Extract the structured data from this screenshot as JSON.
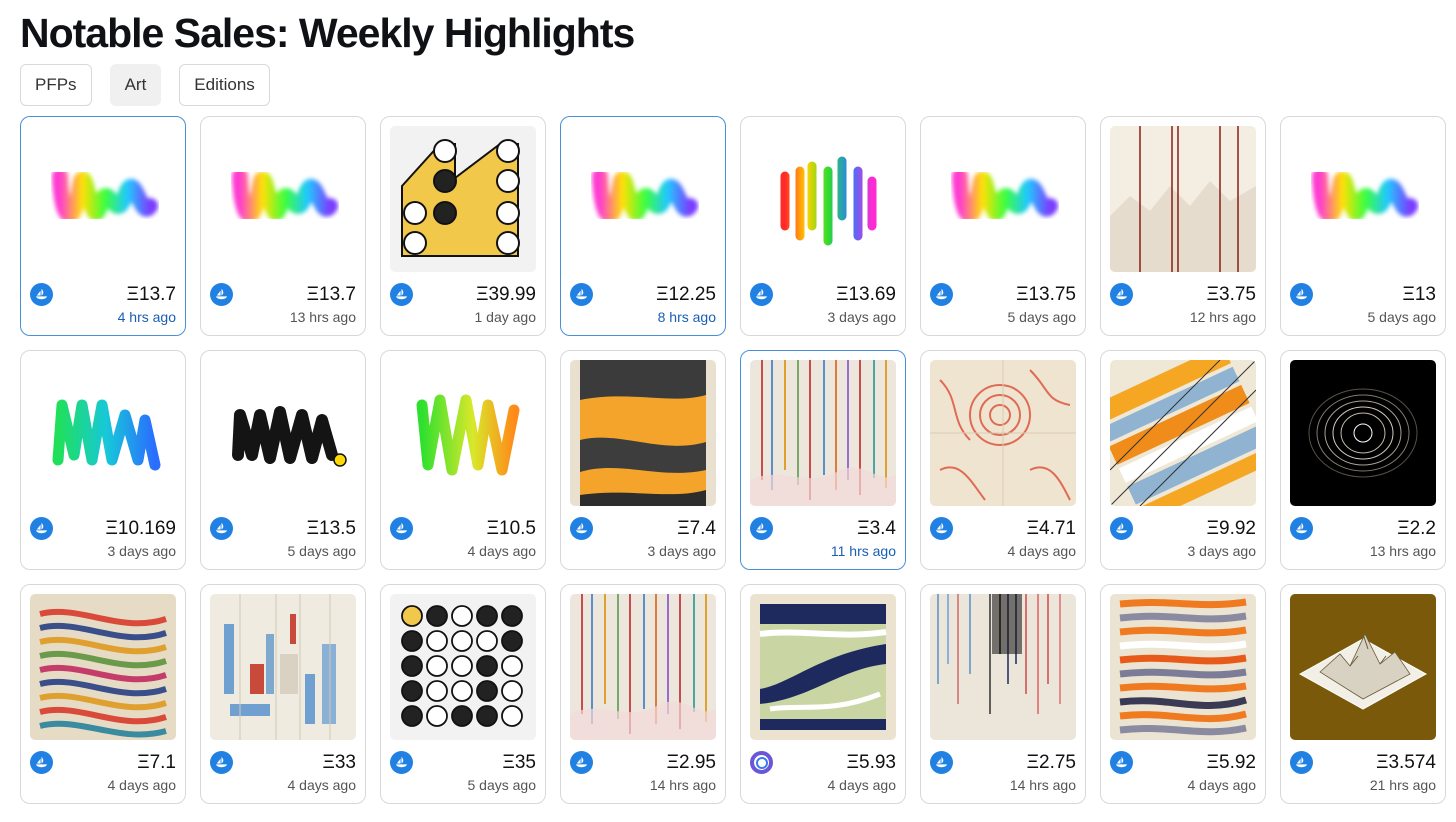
{
  "page": {
    "title": "Notable Sales: Weekly Highlights"
  },
  "tabs": [
    {
      "label": "PFPs",
      "active": false
    },
    {
      "label": "Art",
      "active": true
    },
    {
      "label": "Editions",
      "active": false
    }
  ],
  "cards": [
    {
      "price": "Ξ13.7",
      "time": "4 hrs ago",
      "art": "fuzzy-rainbow",
      "marketplace": "opensea-icon",
      "selected": true
    },
    {
      "price": "Ξ13.7",
      "time": "13 hrs ago",
      "art": "fuzzy-rainbow",
      "marketplace": "opensea-icon",
      "selected": false
    },
    {
      "price": "Ξ39.99",
      "time": "1 day ago",
      "art": "circles-yellow",
      "marketplace": "opensea-icon",
      "selected": false
    },
    {
      "price": "Ξ12.25",
      "time": "8 hrs ago",
      "art": "fuzzy-rainbow",
      "marketplace": "opensea-icon",
      "selected": true
    },
    {
      "price": "Ξ13.69",
      "time": "3 days ago",
      "art": "bold-rainbow",
      "marketplace": "opensea-icon",
      "selected": false
    },
    {
      "price": "Ξ13.75",
      "time": "5 days ago",
      "art": "fuzzy-rainbow",
      "marketplace": "opensea-icon",
      "selected": false
    },
    {
      "price": "Ξ3.75",
      "time": "12 hrs ago",
      "art": "red-lines",
      "marketplace": "opensea-icon",
      "selected": false
    },
    {
      "price": "Ξ13",
      "time": "5 days ago",
      "art": "fuzzy-rainbow",
      "marketplace": "opensea-icon",
      "selected": false
    },
    {
      "price": "Ξ10.169",
      "time": "3 days ago",
      "art": "green-blue-squiggle",
      "marketplace": "opensea-icon",
      "selected": false
    },
    {
      "price": "Ξ13.5",
      "time": "5 days ago",
      "art": "dark-squiggle",
      "marketplace": "opensea-icon",
      "selected": false
    },
    {
      "price": "Ξ10.5",
      "time": "4 days ago",
      "art": "green-orange-squiggle",
      "marketplace": "opensea-icon",
      "selected": false
    },
    {
      "price": "Ξ7.4",
      "time": "3 days ago",
      "art": "orange-strata",
      "marketplace": "opensea-icon",
      "selected": false
    },
    {
      "price": "Ξ3.4",
      "time": "11 hrs ago",
      "art": "color-lines",
      "marketplace": "opensea-icon",
      "selected": true
    },
    {
      "price": "Ξ4.71",
      "time": "4 days ago",
      "art": "red-swirls",
      "marketplace": "opensea-icon",
      "selected": false
    },
    {
      "price": "Ξ9.92",
      "time": "3 days ago",
      "art": "isometric",
      "marketplace": "opensea-icon",
      "selected": false
    },
    {
      "price": "Ξ2.2",
      "time": "13 hrs ago",
      "art": "black-hole",
      "marketplace": "opensea-icon",
      "selected": false
    },
    {
      "price": "Ξ7.1",
      "time": "4 days ago",
      "art": "multi-strata",
      "marketplace": "opensea-icon",
      "selected": false
    },
    {
      "price": "Ξ33",
      "time": "4 days ago",
      "art": "blocks",
      "marketplace": "opensea-icon",
      "selected": false
    },
    {
      "price": "Ξ35",
      "time": "5 days ago",
      "art": "circle-grid",
      "marketplace": "opensea-icon",
      "selected": false
    },
    {
      "price": "Ξ2.95",
      "time": "14 hrs ago",
      "art": "color-lines",
      "marketplace": "opensea-icon",
      "selected": false
    },
    {
      "price": "Ξ5.93",
      "time": "4 days ago",
      "art": "green-strata",
      "marketplace": "foundation-icon",
      "selected": false
    },
    {
      "price": "Ξ2.75",
      "time": "14 hrs ago",
      "art": "dark-lines",
      "marketplace": "opensea-icon",
      "selected": false
    },
    {
      "price": "Ξ5.92",
      "time": "4 days ago",
      "art": "orange-bands",
      "marketplace": "opensea-icon",
      "selected": false
    },
    {
      "price": "Ξ3.574",
      "time": "21 hrs ago",
      "art": "terrain",
      "marketplace": "opensea-icon",
      "selected": false
    }
  ],
  "colors": {
    "accent": "#2081e2",
    "selected_border": "#4a90d9",
    "selected_time": "#1a5fb4"
  }
}
